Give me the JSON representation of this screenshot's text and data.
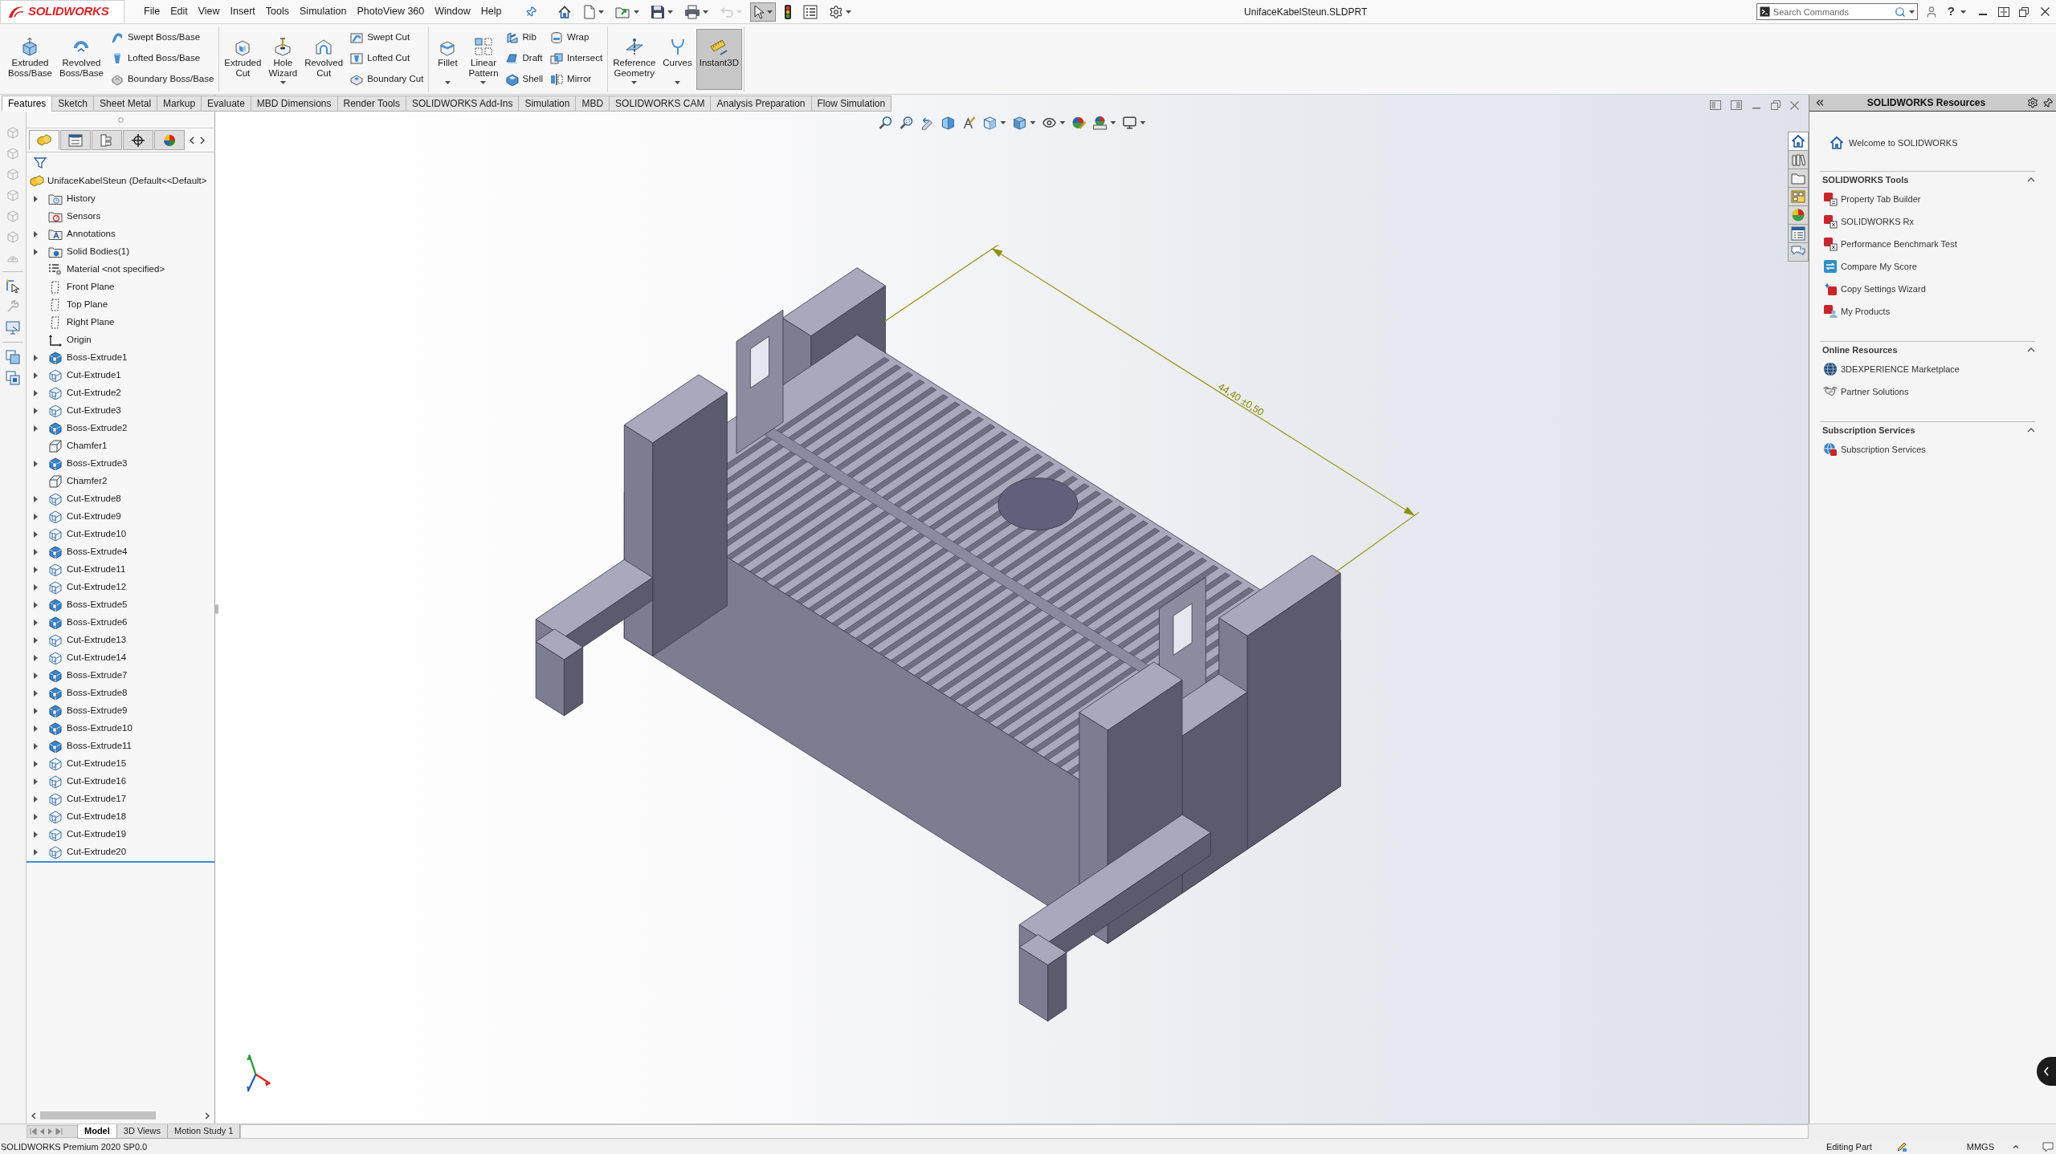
{
  "app": {
    "logo": "SOLIDWORKS",
    "title": "UnifaceKabelSteun.SLDPRT",
    "help": "?"
  },
  "menu": [
    "File",
    "Edit",
    "View",
    "Insert",
    "Tools",
    "Simulation",
    "PhotoView 360",
    "Window",
    "Help"
  ],
  "quick_access": [
    {
      "kind": "home",
      "caret": false,
      "disabled": false,
      "selected": false
    },
    {
      "kind": "new",
      "caret": true,
      "disabled": false,
      "selected": false
    },
    {
      "kind": "open",
      "caret": true,
      "disabled": false,
      "selected": false
    },
    {
      "kind": "save",
      "caret": true,
      "disabled": false,
      "selected": false
    },
    {
      "kind": "print",
      "caret": true,
      "disabled": false,
      "selected": false
    },
    {
      "kind": "undo",
      "caret": true,
      "disabled": true,
      "selected": false
    },
    {
      "kind": "select",
      "caret": true,
      "disabled": false,
      "selected": true
    },
    {
      "kind": "rebuild",
      "caret": false,
      "disabled": false,
      "selected": false
    },
    {
      "kind": "properties",
      "caret": false,
      "disabled": false,
      "selected": false
    },
    {
      "kind": "options",
      "caret": true,
      "disabled": false,
      "selected": false
    }
  ],
  "search": {
    "placeholder": "Search Commands"
  },
  "ribbon": [
    [
      {
        "kind": "large",
        "label": "Extruded Boss/Base",
        "caret": false,
        "on": false
      },
      {
        "kind": "large",
        "label": "Revolved Boss/Base",
        "caret": false,
        "on": false
      },
      {
        "kind": "stack",
        "items": [
          "Swept Boss/Base",
          "Lofted Boss/Base",
          "Boundary Boss/Base"
        ]
      }
    ],
    [
      {
        "kind": "large",
        "label": "Extruded Cut",
        "caret": false,
        "on": false
      },
      {
        "kind": "large",
        "label": "Hole Wizard",
        "caret": true,
        "on": false
      },
      {
        "kind": "large",
        "label": "Revolved Cut",
        "caret": false,
        "on": false
      },
      {
        "kind": "stack",
        "items": [
          "Swept Cut",
          "Lofted Cut",
          "Boundary Cut"
        ]
      }
    ],
    [
      {
        "kind": "large",
        "label": "Fillet",
        "caret": true,
        "on": false
      },
      {
        "kind": "large",
        "label": "Linear Pattern",
        "caret": true,
        "on": false
      },
      {
        "kind": "stack",
        "items": [
          "Rib",
          "Draft",
          "Shell"
        ]
      },
      {
        "kind": "stack",
        "items": [
          "Wrap",
          "Intersect",
          "Mirror"
        ]
      }
    ],
    [
      {
        "kind": "large",
        "label": "Reference Geometry",
        "caret": true,
        "on": false
      },
      {
        "kind": "large",
        "label": "Curves",
        "caret": true,
        "on": false
      },
      {
        "kind": "large",
        "label": "Instant3D",
        "caret": false,
        "on": true
      }
    ]
  ],
  "command_tabs": [
    {
      "label": "Features",
      "selected": true
    },
    {
      "label": "Sketch",
      "selected": false
    },
    {
      "label": "Sheet Metal",
      "selected": false
    },
    {
      "label": "Markup",
      "selected": false
    },
    {
      "label": "Evaluate",
      "selected": false
    },
    {
      "label": "MBD Dimensions",
      "selected": false
    },
    {
      "label": "Render Tools",
      "selected": false
    },
    {
      "label": "SOLIDWORKS Add-Ins",
      "selected": false
    },
    {
      "label": "Simulation",
      "selected": false
    },
    {
      "label": "MBD",
      "selected": false
    },
    {
      "label": "SOLIDWORKS CAM",
      "selected": false
    },
    {
      "label": "Analysis Preparation",
      "selected": false
    },
    {
      "label": "Flow Simulation",
      "selected": false
    }
  ],
  "feature_tree": {
    "tabs": [
      {
        "kind": "features",
        "selected": true
      },
      {
        "kind": "properties",
        "selected": false
      },
      {
        "kind": "configurations",
        "selected": false
      },
      {
        "kind": "dimxpert",
        "selected": false
      },
      {
        "kind": "display",
        "selected": false
      }
    ],
    "root": "UnifaceKabelSteun (Default<<Default>",
    "items": [
      {
        "label": "History",
        "kind": "history",
        "expandable": true
      },
      {
        "label": "Sensors",
        "kind": "sensors",
        "expandable": false
      },
      {
        "label": "Annotations",
        "kind": "annotations",
        "expandable": true
      },
      {
        "label": "Solid Bodies(1)",
        "kind": "bodies",
        "expandable": true
      },
      {
        "label": "Material <not specified>",
        "kind": "material",
        "expandable": false
      },
      {
        "label": "Front Plane",
        "kind": "plane",
        "expandable": false
      },
      {
        "label": "Top Plane",
        "kind": "plane",
        "expandable": false
      },
      {
        "label": "Right Plane",
        "kind": "plane",
        "expandable": false
      },
      {
        "label": "Origin",
        "kind": "origin",
        "expandable": false
      },
      {
        "label": "Boss-Extrude1",
        "kind": "boss",
        "expandable": true
      },
      {
        "label": "Cut-Extrude1",
        "kind": "cut",
        "expandable": true
      },
      {
        "label": "Cut-Extrude2",
        "kind": "cut",
        "expandable": true
      },
      {
        "label": "Cut-Extrude3",
        "kind": "cut",
        "expandable": true
      },
      {
        "label": "Boss-Extrude2",
        "kind": "boss",
        "expandable": true
      },
      {
        "label": "Chamfer1",
        "kind": "chamfer",
        "expandable": false
      },
      {
        "label": "Boss-Extrude3",
        "kind": "boss",
        "expandable": true
      },
      {
        "label": "Chamfer2",
        "kind": "chamfer",
        "expandable": false
      },
      {
        "label": "Cut-Extrude8",
        "kind": "cut",
        "expandable": true
      },
      {
        "label": "Cut-Extrude9",
        "kind": "cut",
        "expandable": true
      },
      {
        "label": "Cut-Extrude10",
        "kind": "cut",
        "expandable": true
      },
      {
        "label": "Boss-Extrude4",
        "kind": "boss",
        "expandable": true
      },
      {
        "label": "Cut-Extrude11",
        "kind": "cut",
        "expandable": true
      },
      {
        "label": "Cut-Extrude12",
        "kind": "cut",
        "expandable": true
      },
      {
        "label": "Boss-Extrude5",
        "kind": "boss",
        "expandable": true
      },
      {
        "label": "Boss-Extrude6",
        "kind": "boss",
        "expandable": true
      },
      {
        "label": "Cut-Extrude13",
        "kind": "cut",
        "expandable": true
      },
      {
        "label": "Cut-Extrude14",
        "kind": "cut",
        "expandable": true
      },
      {
        "label": "Boss-Extrude7",
        "kind": "boss",
        "expandable": true
      },
      {
        "label": "Boss-Extrude8",
        "kind": "boss",
        "expandable": true
      },
      {
        "label": "Boss-Extrude9",
        "kind": "boss",
        "expandable": true
      },
      {
        "label": "Boss-Extrude10",
        "kind": "boss",
        "expandable": true
      },
      {
        "label": "Boss-Extrude11",
        "kind": "boss",
        "expandable": true
      },
      {
        "label": "Cut-Extrude15",
        "kind": "cut",
        "expandable": true
      },
      {
        "label": "Cut-Extrude16",
        "kind": "cut",
        "expandable": true
      },
      {
        "label": "Cut-Extrude17",
        "kind": "cut",
        "expandable": true
      },
      {
        "label": "Cut-Extrude18",
        "kind": "cut",
        "expandable": true
      },
      {
        "label": "Cut-Extrude19",
        "kind": "cut",
        "expandable": true
      },
      {
        "label": "Cut-Extrude20",
        "kind": "cut",
        "expandable": true
      }
    ]
  },
  "viewport": {
    "dimension": "44,40 ±0,50"
  },
  "task_pane": {
    "title": "SOLIDWORKS Resources",
    "tabs": [
      {
        "kind": "home",
        "selected": true
      },
      {
        "kind": "library",
        "selected": false
      },
      {
        "kind": "explorer",
        "selected": false
      },
      {
        "kind": "palette",
        "selected": false
      },
      {
        "kind": "appearances",
        "selected": false
      },
      {
        "kind": "properties",
        "selected": false
      },
      {
        "kind": "forum",
        "selected": false
      }
    ],
    "welcome": "Welcome to SOLIDWORKS",
    "sections": [
      {
        "title": "SOLIDWORKS Tools",
        "expanded": true,
        "items": [
          "Property Tab Builder",
          "SOLIDWORKS Rx",
          "Performance Benchmark Test",
          "Compare My Score",
          "Copy Settings Wizard",
          "My Products"
        ]
      },
      {
        "title": "Online Resources",
        "expanded": true,
        "items": [
          "3DEXPERIENCE Marketplace",
          "Partner Solutions"
        ]
      },
      {
        "title": "Subscription Services",
        "expanded": true,
        "items": [
          "Subscription Services"
        ]
      }
    ]
  },
  "bottom_tabs": [
    {
      "label": "Model",
      "selected": true
    },
    {
      "label": "3D Views",
      "selected": false
    },
    {
      "label": "Motion Study 1",
      "selected": false
    }
  ],
  "status_bar": {
    "product": "SOLIDWORKS Premium 2020 SP0.0",
    "mode": "Editing Part",
    "units": "MMGS"
  }
}
